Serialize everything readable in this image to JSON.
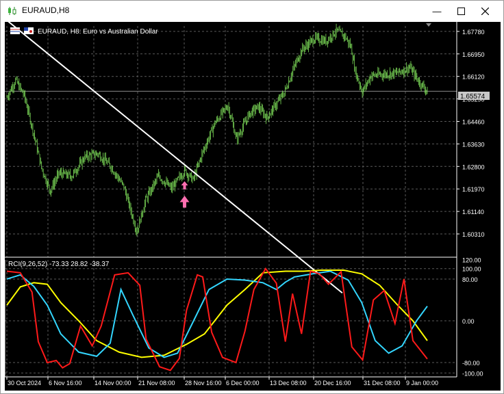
{
  "window": {
    "title": "EURAUD,H8"
  },
  "main_panel": {
    "header": "EURAUD, H8:  Euro vs Australian Dollar",
    "price_ticks": [
      "1.67780",
      "1.66950",
      "1.66120",
      "1.65290",
      "1.64460",
      "1.63630",
      "1.62800",
      "1.61970",
      "1.61140",
      "1.60310"
    ],
    "current_price": "1.65574"
  },
  "indicator_panel": {
    "label": "RCI(9,26,52) -73.33 28.82 -38.37",
    "ticks": [
      "120.00",
      "100.00",
      "80.00",
      "0.00",
      "-80.00",
      "-100.00"
    ]
  },
  "time_axis": [
    "30 Oct 2024",
    "6 Nov 16:00",
    "14 Nov 00:00",
    "21 Nov 08:00",
    "28 Nov 16:00",
    "6 Dec 00:00",
    "13 Dec 08:00",
    "20 Dec 16:00",
    "31 Dec 08:00",
    "9 Jan 00:00"
  ],
  "colors": {
    "bull": "#7fe05a",
    "trendline": "#ffffff",
    "rci_fast": "#ff1a1a",
    "rci_mid": "#ffff00",
    "rci_slow": "#33d6ff",
    "arrow": "#ff6fb0",
    "grid": "#5a5a5a"
  },
  "chart_data": {
    "type": "candlestick",
    "symbol": "EURAUD",
    "timeframe": "H8",
    "close_path": [
      [
        0,
        1.6535
      ],
      [
        10,
        1.6598
      ],
      [
        20,
        1.6542
      ],
      [
        30,
        1.6415
      ],
      [
        40,
        1.6275
      ],
      [
        50,
        1.619
      ],
      [
        60,
        1.6255
      ],
      [
        75,
        1.6245
      ],
      [
        90,
        1.6315
      ],
      [
        105,
        1.6328
      ],
      [
        120,
        1.628
      ],
      [
        135,
        1.6205
      ],
      [
        145,
        1.6095
      ],
      [
        150,
        1.604
      ],
      [
        160,
        1.6155
      ],
      [
        175,
        1.6245
      ],
      [
        190,
        1.6198
      ],
      [
        205,
        1.6265
      ],
      [
        215,
        1.623
      ],
      [
        225,
        1.6325
      ],
      [
        240,
        1.644
      ],
      [
        255,
        1.6505
      ],
      [
        265,
        1.638
      ],
      [
        280,
        1.6475
      ],
      [
        290,
        1.65
      ],
      [
        300,
        1.646
      ],
      [
        320,
        1.6552
      ],
      [
        330,
        1.6635
      ],
      [
        340,
        1.671
      ],
      [
        355,
        1.6752
      ],
      [
        368,
        1.6742
      ],
      [
        380,
        1.678
      ],
      [
        390,
        1.676
      ],
      [
        397,
        1.672
      ],
      [
        402,
        1.663
      ],
      [
        410,
        1.6555
      ],
      [
        420,
        1.6615
      ],
      [
        435,
        1.662
      ],
      [
        450,
        1.6625
      ],
      [
        465,
        1.6645
      ],
      [
        475,
        1.6595
      ],
      [
        485,
        1.6558
      ]
    ],
    "trendline": [
      [
        0,
        1.6612
      ],
      [
        304,
        1.598
      ]
    ],
    "signal_arrow": {
      "bar": 205,
      "price": 1.6195
    },
    "rci": {
      "fast": [
        [
          0,
          95
        ],
        [
          15,
          92
        ],
        [
          28,
          55
        ],
        [
          35,
          -40
        ],
        [
          45,
          -80
        ],
        [
          55,
          -76
        ],
        [
          62,
          -90
        ],
        [
          70,
          -82
        ],
        [
          82,
          -10
        ],
        [
          95,
          -48
        ],
        [
          105,
          -10
        ],
        [
          120,
          88
        ],
        [
          135,
          92
        ],
        [
          148,
          68
        ],
        [
          155,
          -35
        ],
        [
          170,
          -88
        ],
        [
          182,
          -95
        ],
        [
          192,
          -72
        ],
        [
          200,
          20
        ],
        [
          212,
          88
        ],
        [
          218,
          84
        ],
        [
          228,
          -22
        ],
        [
          240,
          -70
        ],
        [
          255,
          -80
        ],
        [
          265,
          -20
        ],
        [
          275,
          60
        ],
        [
          288,
          100
        ],
        [
          300,
          72
        ],
        [
          310,
          -40
        ],
        [
          318,
          52
        ],
        [
          328,
          -25
        ],
        [
          338,
          95
        ],
        [
          348,
          90
        ],
        [
          358,
          70
        ],
        [
          372,
          94
        ],
        [
          384,
          -50
        ],
        [
          396,
          -75
        ],
        [
          408,
          40
        ],
        [
          420,
          58
        ],
        [
          432,
          -5
        ],
        [
          442,
          80
        ],
        [
          452,
          -38
        ],
        [
          468,
          -73
        ]
      ],
      "mid": [
        [
          0,
          30
        ],
        [
          15,
          65
        ],
        [
          30,
          73
        ],
        [
          45,
          70
        ],
        [
          60,
          35
        ],
        [
          80,
          0
        ],
        [
          100,
          -38
        ],
        [
          125,
          -60
        ],
        [
          150,
          -70
        ],
        [
          175,
          -66
        ],
        [
          200,
          -45
        ],
        [
          220,
          -25
        ],
        [
          245,
          30
        ],
        [
          265,
          60
        ],
        [
          285,
          92
        ],
        [
          310,
          95
        ],
        [
          330,
          95
        ],
        [
          350,
          97
        ],
        [
          375,
          97
        ],
        [
          395,
          90
        ],
        [
          415,
          68
        ],
        [
          435,
          30
        ],
        [
          452,
          0
        ],
        [
          468,
          -38
        ]
      ],
      "slow": [
        [
          0,
          80
        ],
        [
          15,
          88
        ],
        [
          30,
          66
        ],
        [
          45,
          30
        ],
        [
          60,
          -25
        ],
        [
          80,
          -60
        ],
        [
          100,
          -68
        ],
        [
          115,
          -43
        ],
        [
          127,
          60
        ],
        [
          140,
          12
        ],
        [
          158,
          -52
        ],
        [
          175,
          -70
        ],
        [
          190,
          -62
        ],
        [
          205,
          -10
        ],
        [
          225,
          60
        ],
        [
          245,
          80
        ],
        [
          265,
          78
        ],
        [
          285,
          73
        ],
        [
          300,
          60
        ],
        [
          310,
          74
        ],
        [
          320,
          84
        ],
        [
          340,
          90
        ],
        [
          360,
          95
        ],
        [
          380,
          78
        ],
        [
          395,
          35
        ],
        [
          410,
          -38
        ],
        [
          425,
          -62
        ],
        [
          440,
          -48
        ],
        [
          456,
          0
        ],
        [
          468,
          28
        ]
      ]
    }
  }
}
